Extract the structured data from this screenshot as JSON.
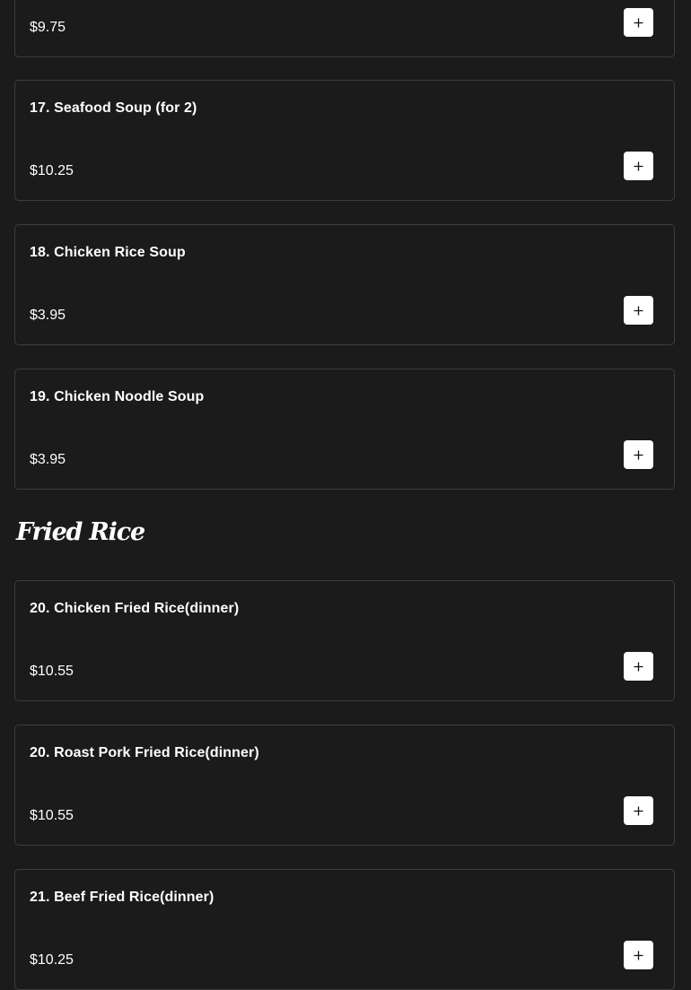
{
  "menu": {
    "partial_top_item": {
      "price": "$9.75"
    },
    "soups": [
      {
        "name": "17. Seafood Soup (for 2)",
        "price": "$10.25"
      },
      {
        "name": "18. Chicken Rice Soup",
        "price": "$3.95"
      },
      {
        "name": "19. Chicken Noodle Soup",
        "price": "$3.95"
      }
    ],
    "fried_rice_section": {
      "title": "Fried Rice",
      "items": [
        {
          "name": "20. Chicken Fried Rice(dinner)",
          "price": "$10.55"
        },
        {
          "name": "20. Roast Pork Fried Rice(dinner)",
          "price": "$10.55"
        },
        {
          "name": "21. Beef Fried Rice(dinner)",
          "price": "$10.25"
        }
      ]
    }
  },
  "icons": {
    "add_button": "plus-icon"
  },
  "colors": {
    "background": "#1b1b1b",
    "card_border": "#3e3e3e",
    "add_button": "#ffffff",
    "text": "#ffffff"
  }
}
